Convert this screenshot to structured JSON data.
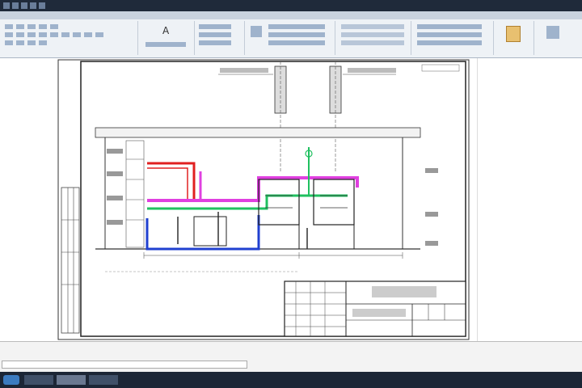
{
  "ribbon_tabs": [],
  "status": {
    "command_prompt": "",
    "clock": ""
  },
  "colors": {
    "red_pipe": "#e02020",
    "green_pipe": "#20c060",
    "magenta_pipe": "#e040e0",
    "blue_pipe": "#2040d0",
    "dark_pipe": "#303030"
  },
  "icons": {
    "titlebar": [
      "app-menu-icon",
      "save-icon",
      "undo-icon",
      "redo-icon",
      "print-icon"
    ],
    "taskbar": [
      "start-icon",
      "explorer-icon",
      "autocad-icon",
      "browser-icon"
    ]
  }
}
